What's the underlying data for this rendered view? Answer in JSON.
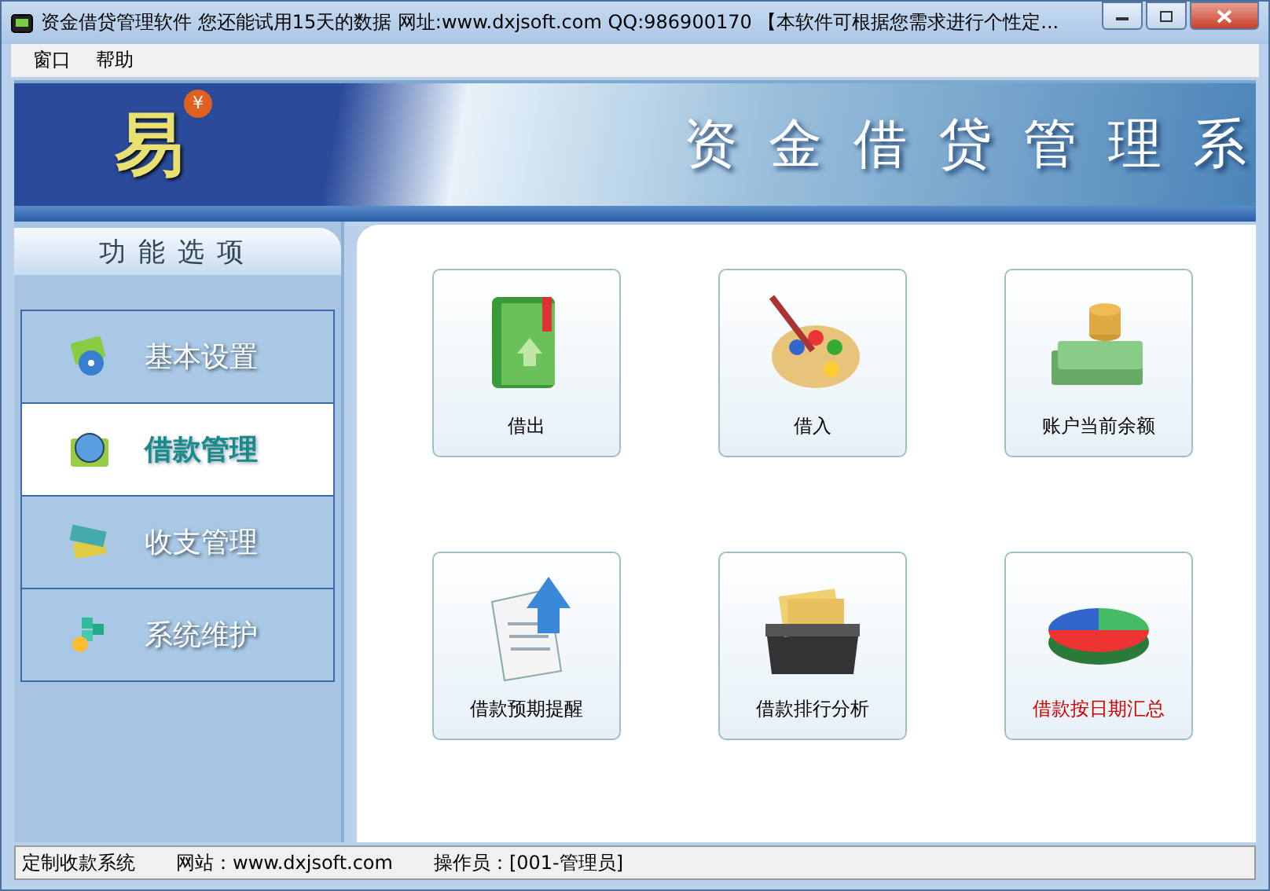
{
  "window": {
    "title": "资金借贷管理软件  您还能试用15天的数据   网址:www.dxjsoft.com   QQ:986900170   【本软件可根据您需求进行个性定..."
  },
  "menu": [
    "窗口",
    "帮助"
  ],
  "banner": {
    "logo": "易",
    "badge": "¥",
    "title": "资金借贷管理系"
  },
  "sidebar": {
    "header": "功能选项",
    "items": [
      {
        "label": "基本设置",
        "selected": false
      },
      {
        "label": "借款管理",
        "selected": true
      },
      {
        "label": "收支管理",
        "selected": false
      },
      {
        "label": "系统维护",
        "selected": false
      }
    ]
  },
  "tiles": [
    {
      "label": "借出",
      "selected": false
    },
    {
      "label": "借入",
      "selected": false
    },
    {
      "label": "账户当前余额",
      "selected": false
    },
    {
      "label": "借款预期提醒",
      "selected": false
    },
    {
      "label": "借款排行分析",
      "selected": false
    },
    {
      "label": "借款按日期汇总",
      "selected": true
    }
  ],
  "status_bar": [
    "定制收款系统",
    "网站：www.dxjsoft.com",
    "操作员：[001-管理员]"
  ]
}
